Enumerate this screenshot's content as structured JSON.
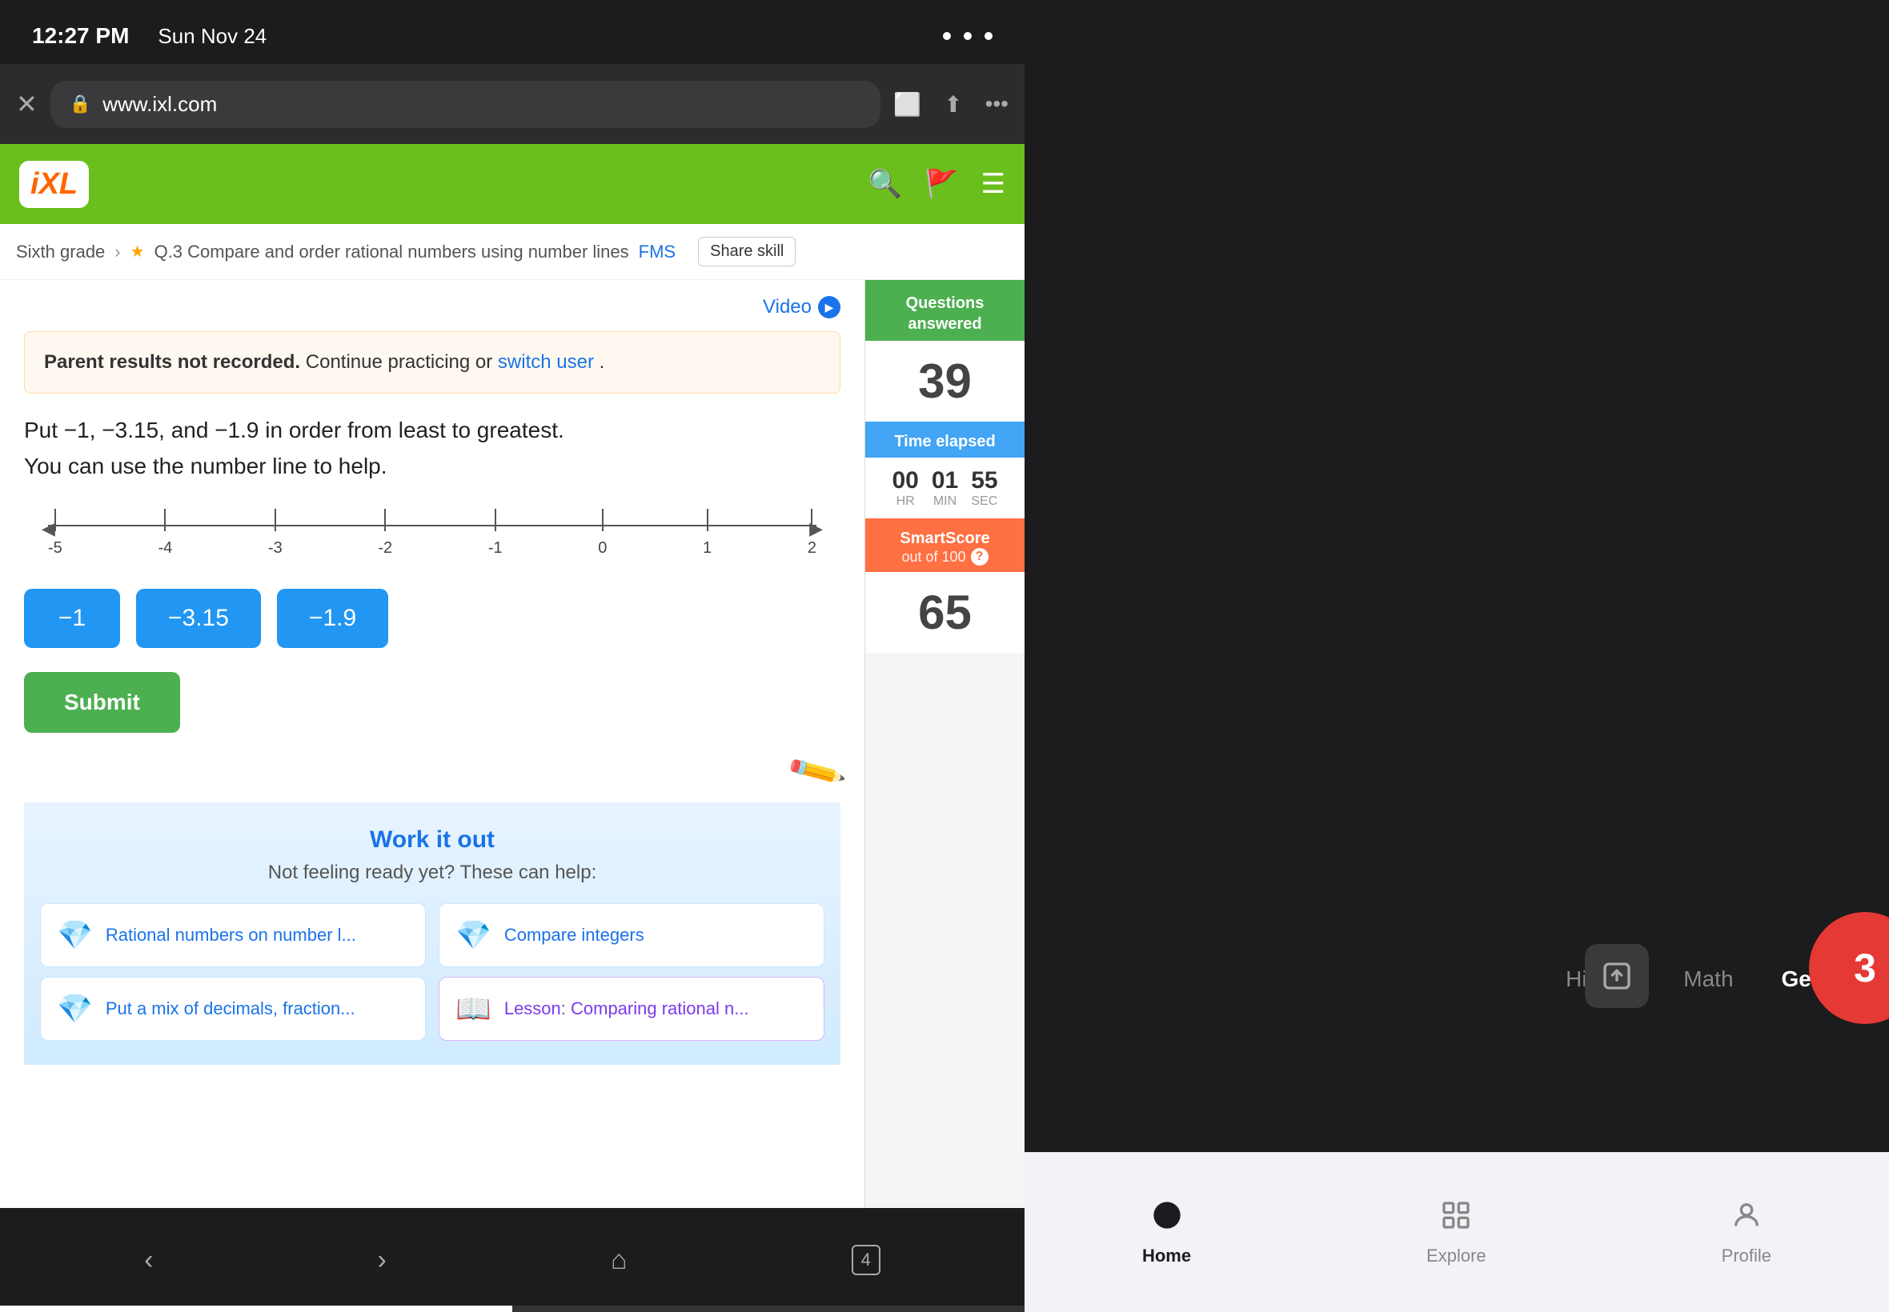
{
  "statusBar": {
    "time": "12:27 PM",
    "date": "Sun Nov 24"
  },
  "browser": {
    "url": "www.ixl.com",
    "tabCount": "4"
  },
  "ixl": {
    "logoText": "IXL",
    "breadcrumb": {
      "grade": "Sixth grade",
      "skill": "Q.3 Compare and order rational numbers using number lines",
      "fms": "FMS",
      "shareBtn": "Share skill"
    },
    "videoLabel": "Video",
    "parentNotice": {
      "boldText": "Parent results not recorded.",
      "text": " Continue practicing or ",
      "linkText": "switch user",
      "endText": "."
    },
    "questionText": "Put −1, −3.15, and −1.9 in order from least to greatest.\nYou can use the number line to help.",
    "numberLine": {
      "labels": [
        "-5",
        "-4",
        "-3",
        "-2",
        "-1",
        "0",
        "1",
        "2"
      ]
    },
    "answerBlocks": [
      "-1",
      "-3.15",
      "-1.9"
    ],
    "submitLabel": "Submit",
    "workItOut": {
      "title": "Work it out",
      "subtitle": "Not feeling ready yet? These can help:",
      "resources": [
        {
          "icon": "💎",
          "text": "Rational numbers on number l...",
          "type": "diamond"
        },
        {
          "icon": "💎",
          "text": "Compare integers",
          "type": "diamond"
        },
        {
          "icon": "💎",
          "text": "Put a mix of decimals, fraction...",
          "type": "diamond"
        },
        {
          "icon": "📖",
          "text": "Lesson: Comparing rational n...",
          "type": "lesson"
        }
      ]
    }
  },
  "sidebar": {
    "questionsAnswered": {
      "label": "Questions answered",
      "value": "39"
    },
    "timeElapsed": {
      "label": "Time elapsed",
      "hours": "00",
      "minutes": "01",
      "seconds": "55",
      "hrLabel": "HR",
      "minLabel": "MIN",
      "secLabel": "SEC"
    },
    "smartScore": {
      "label": "SmartScore",
      "sublabel": "out of 100",
      "value": "65"
    }
  },
  "appPanel": {
    "menuItems": [
      "History",
      "Math",
      "Gen"
    ],
    "tabBar": {
      "tabs": [
        {
          "icon": "⊙",
          "label": "Home",
          "active": true
        },
        {
          "icon": "⊞",
          "label": "Explore",
          "active": false
        },
        {
          "icon": "☺",
          "label": "Profile",
          "active": false
        }
      ]
    }
  }
}
